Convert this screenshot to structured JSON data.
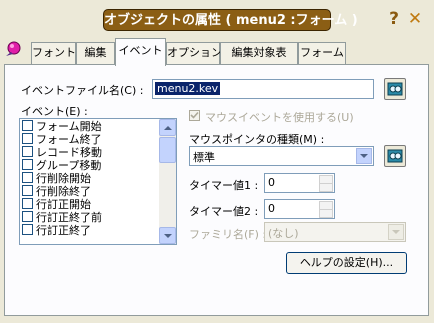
{
  "window": {
    "title": "オブジェクトの属性 ( menu2 :フォーム )"
  },
  "titlebar_buttons": {
    "help": "?",
    "close": "✕"
  },
  "tabs": [
    {
      "label": "フォント",
      "active": false
    },
    {
      "label": "編集",
      "active": false
    },
    {
      "label": "イベント",
      "active": true
    },
    {
      "label": "オプション",
      "active": false
    },
    {
      "label": "編集対象表",
      "active": false
    },
    {
      "label": "フォーム",
      "active": false
    }
  ],
  "event_file": {
    "label": "イベントファイル名(C) :",
    "value": "menu2.kev"
  },
  "events": {
    "label": "イベント(E) :",
    "items": [
      "フォーム開始",
      "フォーム終了",
      "レコード移動",
      "グループ移動",
      "行削除開始",
      "行削除終了",
      "行訂正開始",
      "行訂正終了前",
      "行訂正終了"
    ]
  },
  "mouse_event": {
    "label": "マウスイベントを使用する(U)",
    "checked": true,
    "enabled": false
  },
  "mouse_pointer": {
    "label": "マウスポインタの種類(M) :",
    "value": "標準"
  },
  "timer1": {
    "label": "タイマー値1 :",
    "value": "0"
  },
  "timer2": {
    "label": "タイマー値2 :",
    "value": "0"
  },
  "family": {
    "label": "ファミリ名(F) :",
    "value": "(なし)"
  },
  "help_setting_button": {
    "label": "ヘルプの設定(H)..."
  },
  "icons": {
    "app_logo": "app-logo-icon",
    "browse": "binoculars-icon"
  },
  "colors": {
    "title_bg": "#8B5E14",
    "window_bg": "#ECE9D8",
    "selection": "#0A246A"
  }
}
